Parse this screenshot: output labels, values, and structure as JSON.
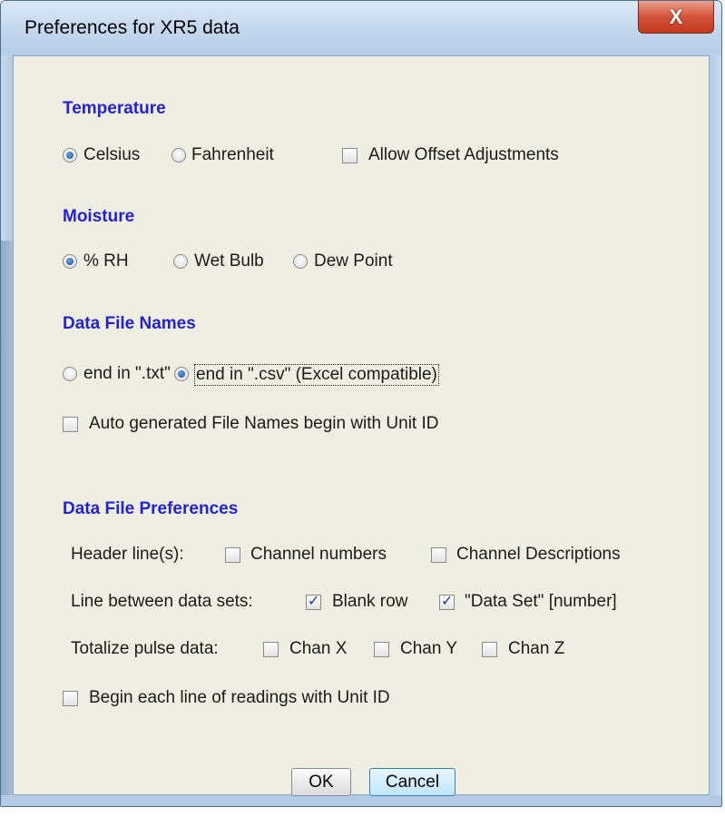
{
  "window": {
    "title": "Preferences for XR5 data",
    "close_glyph": "X"
  },
  "temperature": {
    "title": "Temperature",
    "celsius": "Celsius",
    "fahrenheit": "Fahrenheit",
    "offset": "Allow Offset Adjustments",
    "selected": "Celsius",
    "offset_checked": false
  },
  "moisture": {
    "title": "Moisture",
    "rh": "% RH",
    "wet_bulb": "Wet Bulb",
    "dew_point": "Dew Point",
    "selected": "% RH"
  },
  "file_names": {
    "title": "Data File Names",
    "txt": "end in \".txt\"",
    "csv": "end in \".csv\" (Excel compatible)",
    "selected": "csv",
    "auto_unit_id": "Auto generated File Names begin with Unit ID",
    "auto_unit_id_checked": false
  },
  "file_prefs": {
    "title": "Data File Preferences",
    "header_label": "Header line(s):",
    "channel_numbers": "Channel numbers",
    "channel_descriptions": "Channel Descriptions",
    "line_between_label": "Line between data sets:",
    "blank_row": "Blank row",
    "data_set_number": "\"Data Set\" [number]",
    "totalize_label": "Totalize pulse data:",
    "chan_x": "Chan X",
    "chan_y": "Chan Y",
    "chan_z": "Chan Z",
    "begin_unit_id": "Begin each line of readings with Unit ID",
    "checked": {
      "channel_numbers": false,
      "channel_descriptions": false,
      "blank_row": true,
      "data_set_number": true,
      "chan_x": false,
      "chan_y": false,
      "chan_z": false,
      "begin_unit_id": false
    }
  },
  "buttons": {
    "ok": "OK",
    "cancel": "Cancel"
  },
  "colors": {
    "section_title": "#2323d3",
    "panel_bg": "#efeee3",
    "frame": "#b9d1ea",
    "close": "#c33a20"
  }
}
